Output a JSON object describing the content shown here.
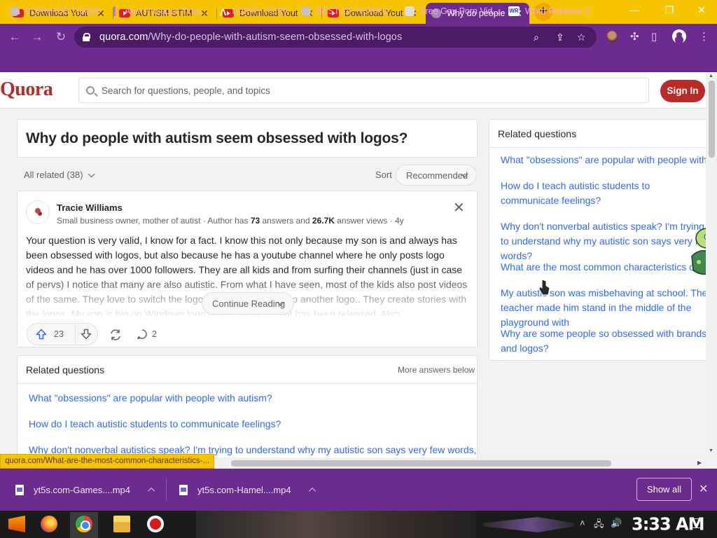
{
  "browser": {
    "tabs": [
      {
        "title": "Download Yout",
        "active": false
      },
      {
        "title": "AUTISM STIM",
        "active": false
      },
      {
        "title": "Download Yout",
        "active": false
      },
      {
        "title": "Download Yout",
        "active": false
      },
      {
        "title": "Why do people",
        "active": true
      }
    ],
    "new_tab_icon": "+",
    "url_domain": "quora.com",
    "url_path": "/Why-do-people-with-autism-seem-obsessed-with-logos",
    "bookmarks": [
      {
        "label": "PORNHUB TRANS",
        "icon": "globe-icon"
      },
      {
        "label": "Anal Prolapse Time...",
        "icon": "video-icon"
      },
      {
        "label": "FURRY PORN",
        "icon": "a-logo-icon"
      },
      {
        "label": "BEST OF HORRO...",
        "icon": "globe-icon"
      },
      {
        "label": "Free Gay Porn Vid...",
        "icon": "skull-icon"
      },
      {
        "label": "Word Replacer II",
        "icon": "wr-icon"
      }
    ]
  },
  "quora": {
    "logo": "Quora",
    "search_placeholder": "Search for questions, people, and topics",
    "sign_in": "Sign In",
    "question_title": "Why do people with autism seem obsessed with logos?",
    "all_related": "All related (38)",
    "sort_label": "Sort",
    "sort_value": "Recommended",
    "answer": {
      "author": "Tracie Williams",
      "cred_prefix": "Small business owner, mother of autist · Author has ",
      "answers_count": "73",
      "cred_mid": " answers and ",
      "answer_views": "26.7K",
      "cred_suffix": " answer views · 4y",
      "body": "Your question is very valid, I know for a fact. I know this not only because my son is and always has been obsessed with logos, but also because he has a youtube channel where he only posts logo videos and he has over 1000 followers. They are all kids and from surfing their channels (just in case of pervs) I notice that many are also autistic. From what I have seen, most of the kids also post videos of the same. They love to switch the logo for a cartoon show to another logo.. They create stories with the logos. My son is big on Windows logo (every version) that has been released. Also",
      "continue_reading": "Continue Reading",
      "upvotes": "23",
      "comments": "2"
    },
    "related_main": {
      "title": "Related questions",
      "more": "More answers below",
      "items": [
        "What \"obsessions\" are popular with people with autism?",
        "How do I teach autistic students to communicate feelings?",
        "Why don't nonverbal autistics speak? I'm trying to understand why my autistic son says very few words,"
      ]
    },
    "related_side": {
      "title": "Related questions",
      "items": [
        "What \"obsessions\" are popular with people with autism?",
        "How do I teach autistic students to communicate feelings?",
        "Why don't nonverbal autistics speak? I'm trying to understand why my autistic son says very few words?",
        "What are the most common characteristics of autism?",
        "My autistic son was misbehaving at school. The teacher made him stand in the middle of the playground with",
        "Why are some people so obsessed with brands and logos?"
      ]
    }
  },
  "status_url": "quora.com/What-are-the-most-common-characteristics-...",
  "downloads": {
    "items": [
      "yt5s.com-Games....mp4",
      "yt5s.com-Hamel....mp4"
    ],
    "show_all": "Show all"
  },
  "taskbar": {
    "clock": "3:33 AM"
  },
  "colors": {
    "accent_tabs": "#f7c400",
    "chrome_purple": "#6c2b8f",
    "quora_red": "#b92b27",
    "link_blue": "#2e69ff"
  }
}
